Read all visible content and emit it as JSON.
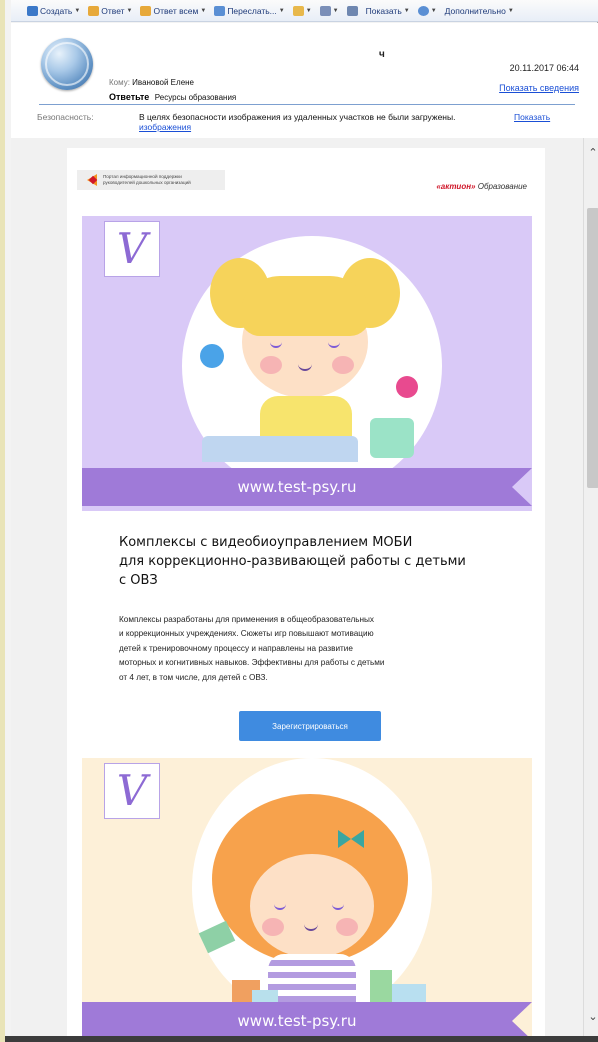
{
  "toolbar": {
    "items": [
      {
        "label": "Создать",
        "icon": "new-icon",
        "color": "#3b78c8"
      },
      {
        "label": "Ответ",
        "icon": "reply-icon",
        "color": "#e7a93a"
      },
      {
        "label": "Ответ всем",
        "icon": "reply-all-icon",
        "color": "#e7a93a"
      },
      {
        "label": "Переслать...",
        "icon": "forward-icon",
        "color": "#5a8fd4"
      },
      {
        "label": "",
        "icon": "folder-icon",
        "color": "#e8b84b"
      },
      {
        "label": "",
        "icon": "flag-icon",
        "color": "#7b8fb8"
      },
      {
        "label": "",
        "icon": "delete-icon",
        "color": "#6f87b0"
      },
      {
        "label": "Показать",
        "icon": "show-icon",
        "color": "#5a8fd4"
      },
      {
        "label": "",
        "icon": "search-icon",
        "color": "#5a8fd4"
      },
      {
        "label": "Дополнительно",
        "icon": "more-icon",
        "color": "#5a8fd4"
      }
    ]
  },
  "header": {
    "subject_mark": "ч",
    "date": "20.11.2017 06:44",
    "to_label": "Кому:",
    "to_value": "Ивановой Елене",
    "show_info": "Показать сведения",
    "reply_bold": "Ответьте",
    "reply_resource": "Ресурсы образования",
    "security_label": "Безопасность:",
    "security_text": "В целях безопасности изображения из удаленных участков не были загружены.",
    "security_link_1": "Показать",
    "security_link_2": "изображения"
  },
  "email": {
    "brand_text_1": "Портал информационной поддержки",
    "brand_text_2": "руководителей дошкольных организаций",
    "aktion_red": "«актион»",
    "aktion_grey": "Образование",
    "banner_logo": "V",
    "ribbon_1": "www.test-psy.ru",
    "ribbon_2": "www.test-psy.ru",
    "headline_1": "Комплексы с видеобиоуправлением МОБИ",
    "headline_2": "для коррекционно-развивающей работы с детьми",
    "headline_3": "с ОВЗ",
    "desc_1": "Комплексы разработаны для применения в общеобразовательных",
    "desc_2": "и коррекционных учреждениях. Сюжеты игр повышают мотивацию",
    "desc_3": "детей к тренировочному процессу и направлены на развитие",
    "desc_4": "моторных и когнитивных навыков. Эффективны для работы с детьми",
    "desc_5": "от 4 лет, в том числе, для детей с ОВЗ.",
    "cta": "Зарегистрироваться"
  },
  "scroll": {
    "up": "⌃",
    "down": "⌄"
  }
}
